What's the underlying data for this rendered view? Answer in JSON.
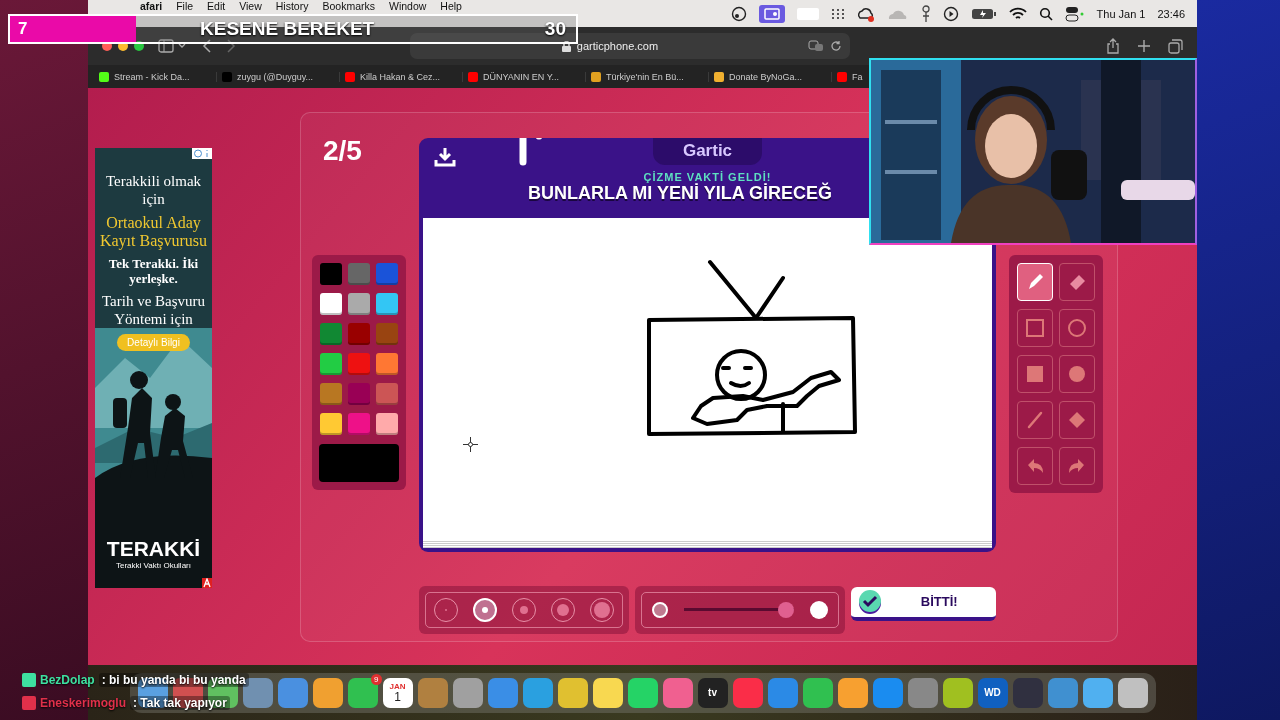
{
  "stream_overlay": {
    "quiz": {
      "number": "7",
      "title": "KESENE BEREKET",
      "timer": "30"
    },
    "chat": [
      {
        "user": "BezDolap",
        "message": ": bi bu yanda bi bu yanda",
        "color": "#3ee0a0"
      },
      {
        "user": "Eneskerimoglu",
        "message": ": Tak tak yapıyor",
        "color": "#e0304a"
      }
    ]
  },
  "menu_bar": {
    "items": [
      "afari",
      "File",
      "Edit",
      "View",
      "History",
      "Bookmarks",
      "Window",
      "Help"
    ],
    "date": "Thu Jan 1",
    "time": "23:46"
  },
  "browser": {
    "address": "garticphone.com",
    "bookmarks": [
      {
        "label": "Stream - Kick Da...",
        "color": "#53fc18"
      },
      {
        "label": "zuygu (@Duyguy...",
        "color": "#000000"
      },
      {
        "label": "Killa Hakan & Cez...",
        "color": "#ff0000"
      },
      {
        "label": "DÜNYANIN EN Y...",
        "color": "#ff0000"
      },
      {
        "label": "Türkiye'nin En Bü...",
        "color": "#e0a020"
      },
      {
        "label": "Donate ByNoGa...",
        "color": "#f0b030"
      },
      {
        "label": "Fa",
        "color": "#ff0000"
      }
    ]
  },
  "ad": {
    "lines": [
      {
        "text": "Terakkili olmak için",
        "kind": "plain"
      },
      {
        "text": "Ortaokul Aday Kayıt Başvurusu",
        "kind": "accent"
      },
      {
        "text": "Tek Terakki. İki yerleşke.",
        "kind": "bold"
      },
      {
        "text": "Tarih ve Başvuru Yöntemi için",
        "kind": "plain"
      }
    ],
    "button": "Detaylı Bilgi",
    "brand": "TERAKKİ",
    "slogan": "Terakki Vaktı Okulları"
  },
  "game": {
    "round": "2/5",
    "logo": "Gartic",
    "subtitle": "ÇİZME VAKTİ GELDİ!",
    "title": "BUNLARLA MI YENİ YILA GİRECEĞ",
    "palette": [
      {
        "color": "#000000"
      },
      {
        "color": "#666666"
      },
      {
        "color": "#1a53d9"
      },
      {
        "color": "#ffffff"
      },
      {
        "color": "#aaaaaa"
      },
      {
        "color": "#33c6f4"
      },
      {
        "color": "#118833"
      },
      {
        "color": "#990000"
      },
      {
        "color": "#994411"
      },
      {
        "color": "#22cc44"
      },
      {
        "color": "#ee1111"
      },
      {
        "color": "#ff7733"
      },
      {
        "color": "#b87722"
      },
      {
        "color": "#990055"
      },
      {
        "color": "#cc5555"
      },
      {
        "color": "#ffc933"
      },
      {
        "color": "#ee1188"
      },
      {
        "color": "#ffaaaa"
      }
    ],
    "tools": [
      {
        "kind": "pencil",
        "selected": true
      },
      {
        "kind": "eraser",
        "selected": false
      },
      {
        "kind": "rect",
        "selected": false
      },
      {
        "kind": "ellipse",
        "selected": false
      },
      {
        "kind": "rect-fill",
        "selected": false
      },
      {
        "kind": "ellipse-fill",
        "selected": false
      },
      {
        "kind": "line",
        "selected": false
      },
      {
        "kind": "fill",
        "selected": false
      },
      {
        "kind": "undo",
        "selected": false
      },
      {
        "kind": "redo",
        "selected": false
      }
    ],
    "sizes": [
      {
        "selected": false
      },
      {
        "selected": true
      },
      {
        "selected": false
      },
      {
        "selected": false
      },
      {
        "selected": false
      }
    ],
    "opacity": {
      "level": 1
    },
    "done_button": "BİTTİ!"
  },
  "dock": [
    {
      "kind": "app",
      "color": "#5aa0e0"
    },
    {
      "kind": "app",
      "color": "#d05050"
    },
    {
      "kind": "app",
      "color": "#60c060"
    },
    {
      "kind": "app",
      "color": "#7090b0"
    },
    {
      "kind": "app",
      "color": "#4a90e0"
    },
    {
      "kind": "app",
      "color": "#f0a030"
    },
    {
      "kind": "app",
      "color": "#30c050",
      "badge": "9"
    },
    {
      "kind": "calendar",
      "color": "#ffffff",
      "month": "JAN",
      "day": "1"
    },
    {
      "kind": "app",
      "color": "#b08040"
    },
    {
      "kind": "app",
      "color": "#a0a0a0"
    },
    {
      "kind": "app",
      "color": "#3a8ee6"
    },
    {
      "kind": "app",
      "color": "#2aa0e0"
    },
    {
      "kind": "app",
      "color": "#e0c030"
    },
    {
      "kind": "app",
      "color": "#f8d850"
    },
    {
      "kind": "app",
      "color": "#25d366"
    },
    {
      "kind": "app",
      "color": "#f06090"
    },
    {
      "kind": "app",
      "color": "#222222",
      "label": "tv"
    },
    {
      "kind": "app",
      "color": "#fa2d48"
    },
    {
      "kind": "app",
      "color": "#2b8ae6"
    },
    {
      "kind": "app",
      "color": "#30c050"
    },
    {
      "kind": "app",
      "color": "#f7a030"
    },
    {
      "kind": "app",
      "color": "#1a8cf0"
    },
    {
      "kind": "app",
      "color": "#888888"
    },
    {
      "kind": "app",
      "color": "#a0c020"
    },
    {
      "kind": "app",
      "color": "#1060c0",
      "label": "WD"
    },
    {
      "kind": "app",
      "color": "#303040"
    },
    {
      "kind": "app",
      "color": "#4090d0"
    },
    {
      "kind": "app",
      "color": "#50b0f0"
    },
    {
      "kind": "app",
      "color": "#c0c0c0"
    }
  ]
}
